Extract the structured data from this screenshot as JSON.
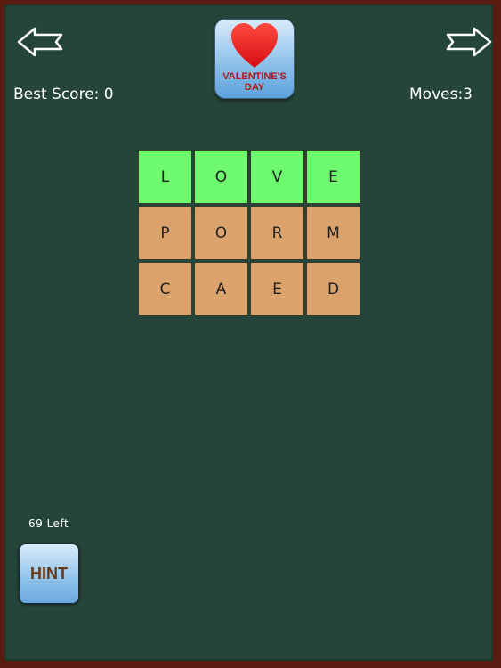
{
  "nav": {
    "back_icon": "arrow-left-icon",
    "forward_icon": "arrow-right-icon"
  },
  "badge": {
    "icon": "heart-icon",
    "title": "VALENTINE'S\nDAY",
    "heart_color": "#e8171b",
    "text_color": "#b51616"
  },
  "scores": {
    "best_score": "Best Score: 0",
    "moves": "Moves:3"
  },
  "grid": {
    "rows": [
      [
        {
          "letter": "L",
          "state": "solved"
        },
        {
          "letter": "O",
          "state": "solved"
        },
        {
          "letter": "V",
          "state": "solved"
        },
        {
          "letter": "E",
          "state": "solved"
        }
      ],
      [
        {
          "letter": "P",
          "state": "open"
        },
        {
          "letter": "O",
          "state": "open"
        },
        {
          "letter": "R",
          "state": "open"
        },
        {
          "letter": "M",
          "state": "open"
        }
      ],
      [
        {
          "letter": "C",
          "state": "open"
        },
        {
          "letter": "A",
          "state": "open"
        },
        {
          "letter": "E",
          "state": "open"
        },
        {
          "letter": "D",
          "state": "open"
        }
      ]
    ],
    "colors": {
      "solved": "#6dfa6f",
      "open": "#dba36b"
    }
  },
  "hints": {
    "left_label": "69 Left",
    "button_label": "HINT"
  },
  "colors": {
    "background": "#264539",
    "frame": "#5a1c10"
  }
}
